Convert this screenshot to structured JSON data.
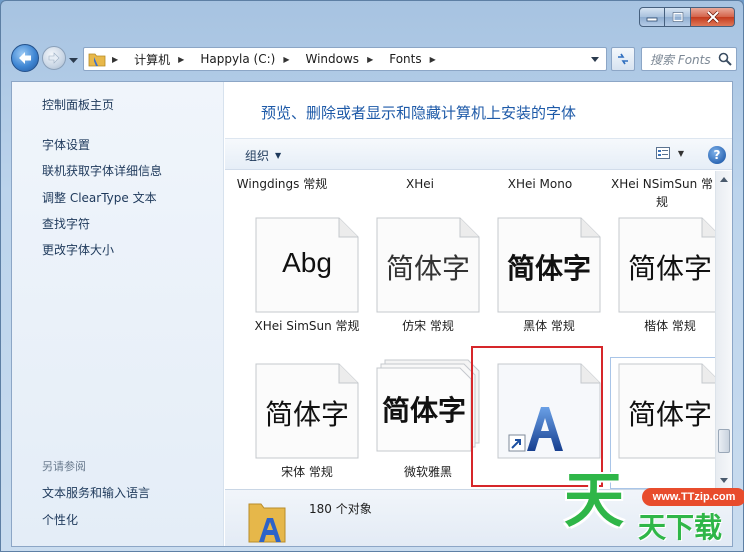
{
  "window": {
    "buttons": {
      "minimize": "minimize-icon",
      "maximize": "maximize-icon",
      "close": "close-icon"
    }
  },
  "address_bar": {
    "crumbs": [
      "计算机",
      "Happyla (C:)",
      "Windows",
      "Fonts"
    ],
    "search_placeholder": "搜索 Fonts"
  },
  "left_pane": {
    "home_link": "控制面板主页",
    "links": [
      "字体设置",
      "联机获取字体详细信息",
      "调整 ClearType 文本",
      "查找字符",
      "更改字体大小"
    ],
    "see_also_heading": "另请参阅",
    "see_also_links": [
      "文本服务和输入语言",
      "个性化"
    ]
  },
  "header": {
    "title": "预览、删除或者显示和隐藏计算机上安装的字体"
  },
  "toolbar": {
    "organize_label": "组织",
    "help_label": "?"
  },
  "fonts": {
    "top_row_names": [
      "Wingdings 常规",
      "XHei",
      "XHei Mono",
      "XHei NSimSun 常规"
    ],
    "row1": [
      {
        "sample": "Abg",
        "name": "XHei SimSun 常规"
      },
      {
        "sample": "简体字",
        "name": "仿宋 常规"
      },
      {
        "sample": "简体字",
        "name": "黑体 常规"
      },
      {
        "sample": "简体字",
        "name": "楷体 常规"
      }
    ],
    "row2": [
      {
        "sample": "简体字",
        "name": "宋体 常规"
      },
      {
        "sample": "简体字",
        "name": "微软雅黑"
      },
      {
        "sample": "",
        "name": ""
      },
      {
        "sample": "简体字",
        "name": ""
      }
    ]
  },
  "details": {
    "count": "180 个对象"
  },
  "watermark": {
    "url": "www.TTzip.com",
    "big": "天",
    "small": "天下载"
  },
  "colors": {
    "accent": "#1e5aa8",
    "selection_outline": "#d6262a",
    "watermark_green": "#2fb648",
    "watermark_red": "#e84c2c"
  }
}
